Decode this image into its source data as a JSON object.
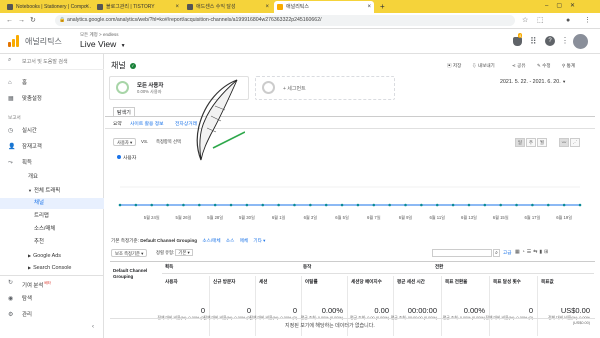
{
  "browser": {
    "tabs": [
      {
        "label": "Notebooks | Stationery | Compo..."
      },
      {
        "label": "블로그관리 | TISTORY"
      },
      {
        "label": "애드센스 수익 달성"
      },
      {
        "label": "애널리틱스"
      }
    ],
    "url": "analytics.google.com/analytics/web/?hl=ko#/report/acquisition-channels/a199916804w276363322p245160662/"
  },
  "header": {
    "app_name": "애널리틱스",
    "account_path": "모든 계정 > endless",
    "view": "Live View",
    "notification_count": "4"
  },
  "sidebar": {
    "search_placeholder": "보고서 및 도움말 검색",
    "items": [
      {
        "label": "홈",
        "icon": "home-icon"
      },
      {
        "label": "맞춤설정",
        "icon": "grid-icon"
      },
      {
        "label": "보고서"
      },
      {
        "label": "실시간",
        "icon": "clock-icon"
      },
      {
        "label": "잠재고객",
        "icon": "person-icon"
      },
      {
        "label": "획득",
        "icon": "acquisition-icon"
      },
      {
        "label": "개요"
      },
      {
        "label": "전체 트래픽"
      },
      {
        "label": "채널"
      },
      {
        "label": "트리맵"
      },
      {
        "label": "소스/매체"
      },
      {
        "label": "추천"
      },
      {
        "label": "Google Ads"
      },
      {
        "label": "Search Console"
      },
      {
        "label": "기여 분석",
        "badge": "베타",
        "icon": "attribution-icon"
      },
      {
        "label": "탐색",
        "icon": "lightbulb-icon"
      },
      {
        "label": "관리",
        "icon": "gear-icon"
      }
    ]
  },
  "report": {
    "title": "채널",
    "actions": [
      "저장",
      "내보내기",
      "공유",
      "수정",
      "통계"
    ],
    "date_range": "2021. 5. 22. - 2021. 6. 20.",
    "segment_all": "모든 사용자",
    "segment_all_sub": "0.00% 사용자",
    "segment_add": "+ 세그먼트",
    "explorer_tab": "탐색기",
    "subtabs": [
      "요약",
      "사이트 활용 정보",
      "전자상거래"
    ],
    "metric_select": "사용자",
    "vs_label": "VS.",
    "metric_select2": "측정항목 선택",
    "period_buttons": [
      "일",
      "주",
      "월"
    ],
    "legend": "사용자",
    "primary_dimension_label": "기본 측정기준:",
    "primary_dimension_value": "Default Channel Grouping",
    "other_dimensions": [
      "소스/매체",
      "소스",
      "매체",
      "기타 ▾"
    ],
    "secondary_dimension": "보조 측정기준 ▾",
    "sort_type": "정렬 유형:",
    "sort_value": "기본 ▾",
    "advanced_label": "고급",
    "table": {
      "dimension_header": "Default Channel Grouping",
      "groups": [
        "획득",
        "동작",
        "전환"
      ],
      "columns": [
        {
          "label": "사용자",
          "value": "0",
          "sub": "전체 대비 비율(%): 0.00% (0)"
        },
        {
          "label": "신규 방문자",
          "value": "0",
          "sub": "전체 대비 비율(%): 0.00% (0)"
        },
        {
          "label": "세션",
          "value": "0",
          "sub": "전체 대비 비율(%): 0.00% (0)"
        },
        {
          "label": "이탈률",
          "value": "0.00%",
          "sub": "평균 조회: 0.00% (0.00%)"
        },
        {
          "label": "세션당 페이지수",
          "value": "0.00",
          "sub": "평균 조회: 0.00 (0.00%)"
        },
        {
          "label": "평균 세션 시간",
          "value": "00:00:00",
          "sub": "평균 조회: 00:00:00 (0.00%)"
        },
        {
          "label": "목표 전환율",
          "value": "0.00%",
          "sub": "평균 조회: 0.00% (0.00%)"
        },
        {
          "label": "목표 달성 횟수",
          "value": "0",
          "sub": "전체 대비 비율(%): 0.00% (0)"
        },
        {
          "label": "목표값",
          "value": "US$0.00",
          "sub": "전체 대비 비율(%): 0.00% (US$0.00)"
        }
      ]
    },
    "empty_message": "지정된 보기에 해당하는 데이터가 없습니다."
  },
  "chart_data": {
    "type": "line",
    "series": [
      {
        "name": "사용자",
        "values": [
          0,
          0,
          0,
          0,
          0,
          0,
          0,
          0,
          0,
          0,
          0,
          0,
          0,
          0,
          0,
          0,
          0,
          0,
          0,
          0,
          0,
          0,
          0,
          0,
          0,
          0,
          0,
          0,
          0,
          0
        ]
      }
    ],
    "x_tick_labels": [
      "5월 24일",
      "5월 26일",
      "5월 28일",
      "5월 30일",
      "6월 1일",
      "6월 3일",
      "6월 5일",
      "6월 7일",
      "6월 9일",
      "6월 11일",
      "6월 13일",
      "6월 15일",
      "6월 17일",
      "6월 19일"
    ],
    "colors": {
      "line": "#1a73e8",
      "points": "#0b8a97"
    }
  }
}
